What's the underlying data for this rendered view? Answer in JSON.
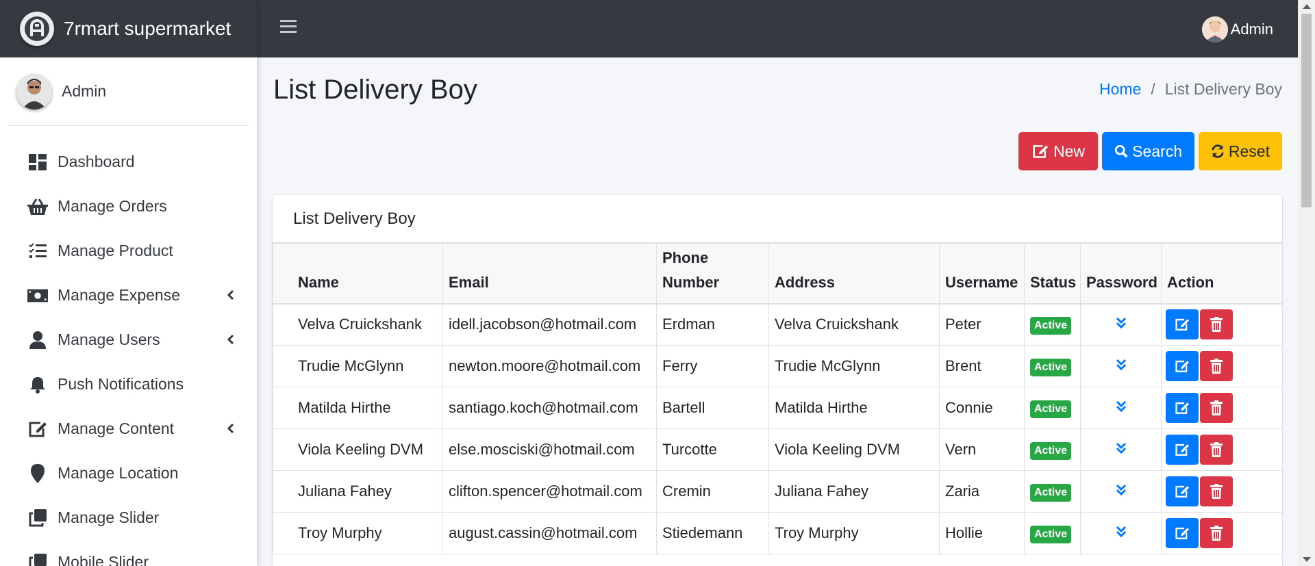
{
  "brand": {
    "name": "7rmart supermarket"
  },
  "sidebar": {
    "user_name": "Admin",
    "items": [
      {
        "label": "Dashboard",
        "icon": "dashboard-icon",
        "has_arrow": false
      },
      {
        "label": "Manage Orders",
        "icon": "basket-icon",
        "has_arrow": false
      },
      {
        "label": "Manage Product",
        "icon": "list-check-icon",
        "has_arrow": false
      },
      {
        "label": "Manage Expense",
        "icon": "money-icon",
        "has_arrow": true
      },
      {
        "label": "Manage Users",
        "icon": "user-icon",
        "has_arrow": true
      },
      {
        "label": "Push Notifications",
        "icon": "bell-icon",
        "has_arrow": false
      },
      {
        "label": "Manage Content",
        "icon": "edit-icon",
        "has_arrow": true
      },
      {
        "label": "Manage Location",
        "icon": "map-marker-icon",
        "has_arrow": false
      },
      {
        "label": "Manage Slider",
        "icon": "clone-icon",
        "has_arrow": false
      },
      {
        "label": "Mobile Slider",
        "icon": "clone-icon",
        "has_arrow": false
      }
    ]
  },
  "topbar": {
    "user_name": "Admin"
  },
  "page": {
    "title": "List Delivery Boy"
  },
  "breadcrumb": {
    "home": "Home",
    "current": "List Delivery Boy"
  },
  "buttons": {
    "new": "New",
    "search": "Search",
    "reset": "Reset"
  },
  "card": {
    "title": "List Delivery Boy"
  },
  "table": {
    "headers": {
      "name": "Name",
      "email": "Email",
      "phone_line1": "Phone",
      "phone_line2": "Number",
      "address": "Address",
      "username": "Username",
      "status": "Status",
      "password": "Password",
      "action": "Action"
    },
    "rows": [
      {
        "name": "Velva Cruickshank",
        "email": "idell.jacobson@hotmail.com",
        "phone": "Erdman",
        "address": "Velva Cruickshank",
        "username": "Peter",
        "status": "Active"
      },
      {
        "name": "Trudie McGlynn",
        "email": "newton.moore@hotmail.com",
        "phone": "Ferry",
        "address": "Trudie McGlynn",
        "username": "Brent",
        "status": "Active"
      },
      {
        "name": "Matilda Hirthe",
        "email": "santiago.koch@hotmail.com",
        "phone": "Bartell",
        "address": "Matilda Hirthe",
        "username": "Connie",
        "status": "Active"
      },
      {
        "name": "Viola Keeling DVM",
        "email": "else.mosciski@hotmail.com",
        "phone": "Turcotte",
        "address": "Viola Keeling DVM",
        "username": "Vern",
        "status": "Active"
      },
      {
        "name": "Juliana Fahey",
        "email": "clifton.spencer@hotmail.com",
        "phone": "Cremin",
        "address": "Juliana Fahey",
        "username": "Zaria",
        "status": "Active"
      },
      {
        "name": "Troy Murphy",
        "email": "august.cassin@hotmail.com",
        "phone": "Stiedemann",
        "address": "Troy Murphy",
        "username": "Hollie",
        "status": "Active"
      }
    ]
  },
  "colors": {
    "primary": "#007bff",
    "danger": "#dc3545",
    "warning": "#ffc107",
    "success": "#28a745",
    "navbar": "#343a40"
  }
}
